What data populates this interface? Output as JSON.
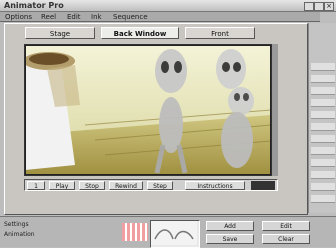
{
  "window": {
    "title": "Animator Pro"
  },
  "menubar": {
    "items": [
      "Options",
      "Reel",
      "Edit",
      "Ink",
      "Sequence"
    ]
  },
  "tabs": [
    {
      "label": "Stage",
      "active": false
    },
    {
      "label": "Back Window",
      "active": true
    },
    {
      "label": "Front",
      "active": false
    }
  ],
  "transport": {
    "frame": "1",
    "buttons": [
      "Play",
      "Stop",
      "Rewind",
      "Step",
      "Instructions"
    ]
  },
  "status": {
    "line1": "Settings",
    "line2": "Animation"
  },
  "bottom_buttons": [
    "Add",
    "Edit",
    "Save",
    "Clear"
  ],
  "colors": {
    "accent_meter": "#f0a0a0",
    "viewer_bg": "#d8d6b8"
  },
  "icons": [
    "close-icon",
    "minimize-icon",
    "maximize-icon"
  ]
}
